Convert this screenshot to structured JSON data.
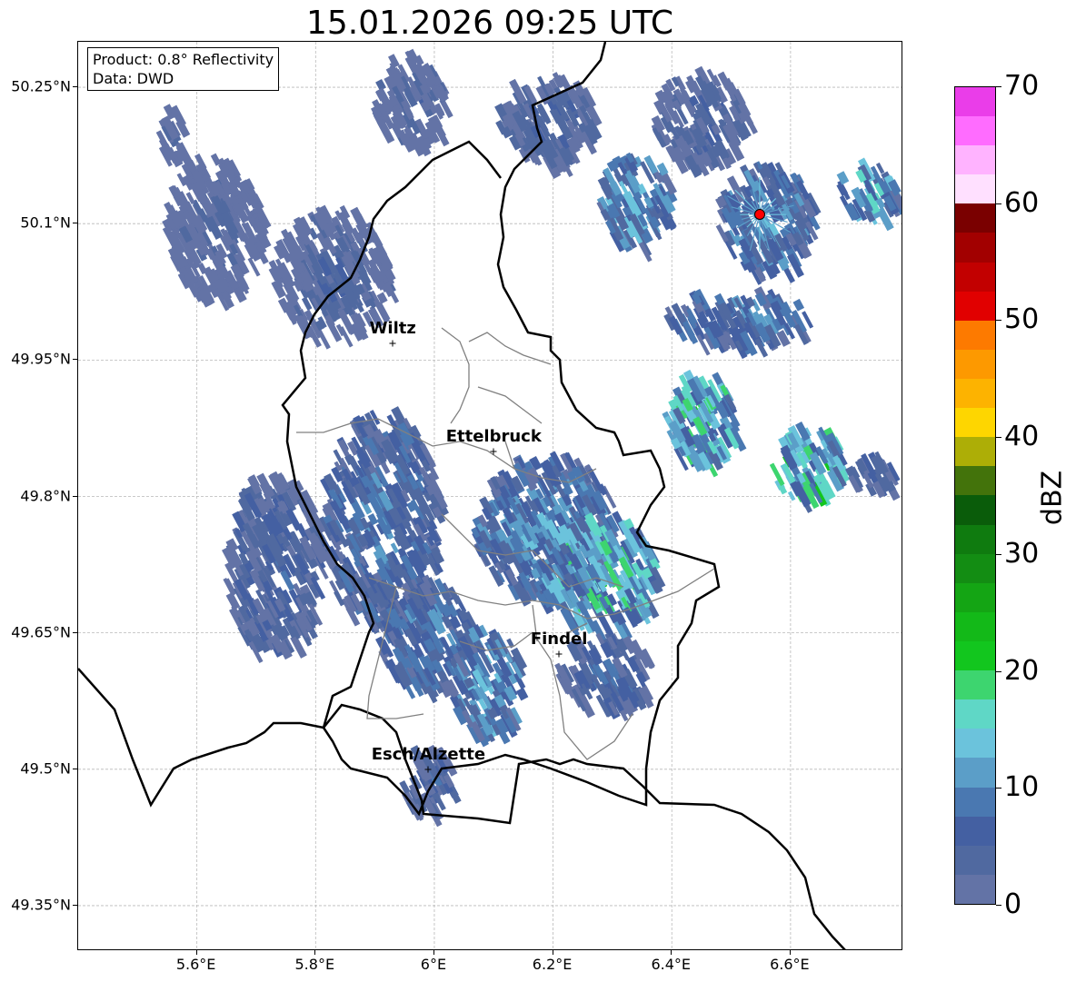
{
  "title": "15.01.2026 09:25 UTC",
  "info": {
    "product": "Product: 0.8° Reflectivity",
    "data": "Data: DWD"
  },
  "map_extent": {
    "lon_min": 5.4,
    "lon_max": 6.79,
    "lat_min": 49.3,
    "lat_max": 50.3
  },
  "lat_ticks": [
    {
      "value": 50.25,
      "label": "50.25°N"
    },
    {
      "value": 50.1,
      "label": "50.1°N"
    },
    {
      "value": 49.95,
      "label": "49.95°N"
    },
    {
      "value": 49.8,
      "label": "49.8°N"
    },
    {
      "value": 49.65,
      "label": "49.65°N"
    },
    {
      "value": 49.5,
      "label": "49.5°N"
    },
    {
      "value": 49.35,
      "label": "49.35°N"
    }
  ],
  "lon_ticks": [
    {
      "value": 5.6,
      "label": "5.6°E"
    },
    {
      "value": 5.8,
      "label": "5.8°E"
    },
    {
      "value": 6.0,
      "label": "6°E"
    },
    {
      "value": 6.2,
      "label": "6.2°E"
    },
    {
      "value": 6.4,
      "label": "6.4°E"
    },
    {
      "value": 6.6,
      "label": "6.6°E"
    }
  ],
  "cities": [
    {
      "name": "Wiltz",
      "lon": 5.93,
      "lat": 49.968
    },
    {
      "name": "Ettelbruck",
      "lon": 6.1,
      "lat": 49.849
    },
    {
      "name": "Findel",
      "lon": 6.21,
      "lat": 49.627
    },
    {
      "name": "Esch/Alzette",
      "lon": 5.99,
      "lat": 49.5
    }
  ],
  "radar_site": {
    "lon": 6.548,
    "lat": 50.11,
    "color": "#ff0000"
  },
  "colorbar": {
    "label": "dBZ",
    "min": 0,
    "max": 70,
    "tick_values": [
      0,
      10,
      20,
      30,
      40,
      50,
      60,
      70
    ],
    "tick_labels": [
      "0",
      "10",
      "20",
      "30",
      "40",
      "50",
      "60",
      "70"
    ],
    "colors": [
      "#6373a6",
      "#5069a0",
      "#4460a2",
      "#4a78b1",
      "#5b9ec8",
      "#6bc3dc",
      "#5fd7c6",
      "#3dd56f",
      "#12c61e",
      "#13b918",
      "#14a514",
      "#138d13",
      "#0f7b0f",
      "#0a5c0a",
      "#43730b",
      "#adae06",
      "#fed600",
      "#fdb300",
      "#fd9900",
      "#fd7a00",
      "#e10000",
      "#c20000",
      "#a20000",
      "#7a0000",
      "#ffe0ff",
      "#ffb3ff",
      "#ff6cff",
      "#ea3de9"
    ]
  },
  "radar_echoes": [
    {
      "lon": 5.62,
      "lat": 50.1,
      "rx": 0.08,
      "ry": 0.08,
      "dbz": 4
    },
    {
      "lon": 5.82,
      "lat": 50.05,
      "rx": 0.1,
      "ry": 0.07,
      "dbz": 5
    },
    {
      "lon": 5.55,
      "lat": 50.2,
      "rx": 0.02,
      "ry": 0.03,
      "dbz": 4
    },
    {
      "lon": 5.95,
      "lat": 50.24,
      "rx": 0.06,
      "ry": 0.05,
      "dbz": 5
    },
    {
      "lon": 6.18,
      "lat": 50.22,
      "rx": 0.08,
      "ry": 0.05,
      "dbz": 6
    },
    {
      "lon": 6.33,
      "lat": 50.13,
      "rx": 0.06,
      "ry": 0.05,
      "dbz": 12
    },
    {
      "lon": 6.55,
      "lat": 50.11,
      "rx": 0.08,
      "ry": 0.06,
      "dbz": 11
    },
    {
      "lon": 6.44,
      "lat": 50.22,
      "rx": 0.08,
      "ry": 0.05,
      "dbz": 6
    },
    {
      "lon": 6.72,
      "lat": 50.14,
      "rx": 0.05,
      "ry": 0.03,
      "dbz": 14
    },
    {
      "lon": 6.5,
      "lat": 50.0,
      "rx": 0.12,
      "ry": 0.03,
      "dbz": 10
    },
    {
      "lon": 6.44,
      "lat": 49.89,
      "rx": 0.06,
      "ry": 0.05,
      "dbz": 17
    },
    {
      "lon": 6.62,
      "lat": 49.84,
      "rx": 0.06,
      "ry": 0.04,
      "dbz": 18
    },
    {
      "lon": 6.73,
      "lat": 49.83,
      "rx": 0.04,
      "ry": 0.02,
      "dbz": 7
    },
    {
      "lon": 6.18,
      "lat": 49.77,
      "rx": 0.12,
      "ry": 0.08,
      "dbz": 11
    },
    {
      "lon": 6.27,
      "lat": 49.72,
      "rx": 0.1,
      "ry": 0.06,
      "dbz": 16
    },
    {
      "lon": 5.9,
      "lat": 49.78,
      "rx": 0.1,
      "ry": 0.12,
      "dbz": 9
    },
    {
      "lon": 5.72,
      "lat": 49.73,
      "rx": 0.08,
      "ry": 0.1,
      "dbz": 7
    },
    {
      "lon": 5.98,
      "lat": 49.65,
      "rx": 0.08,
      "ry": 0.06,
      "dbz": 10
    },
    {
      "lon": 6.08,
      "lat": 49.6,
      "rx": 0.06,
      "ry": 0.06,
      "dbz": 12
    },
    {
      "lon": 6.28,
      "lat": 49.61,
      "rx": 0.08,
      "ry": 0.04,
      "dbz": 8
    },
    {
      "lon": 5.98,
      "lat": 49.49,
      "rx": 0.04,
      "ry": 0.04,
      "dbz": 7
    }
  ]
}
